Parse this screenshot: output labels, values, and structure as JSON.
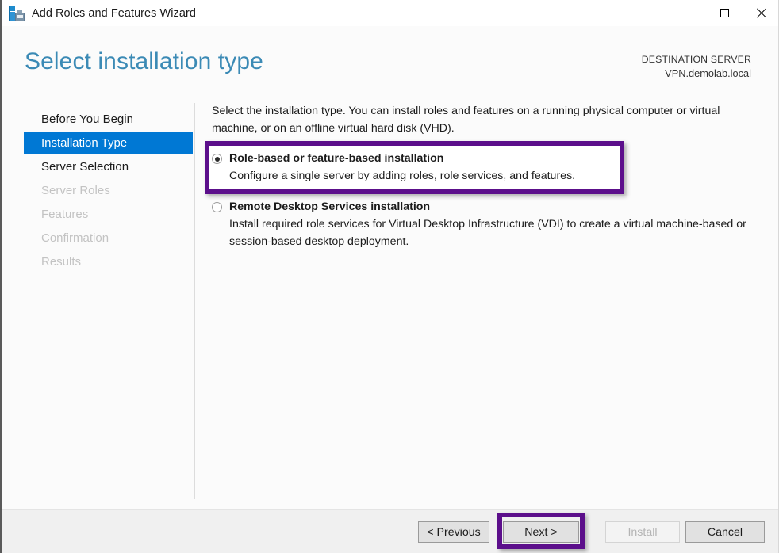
{
  "window": {
    "title": "Add Roles and Features Wizard",
    "app_icon": "server-icon",
    "controls": {
      "minimize": "minimize-icon",
      "maximize": "maximize-icon",
      "close": "close-icon"
    }
  },
  "header": {
    "page_title": "Select installation type",
    "destination_label": "DESTINATION SERVER",
    "destination_value": "VPN.demolab.local"
  },
  "sidebar": {
    "items": [
      {
        "label": "Before You Begin",
        "state": "enabled"
      },
      {
        "label": "Installation Type",
        "state": "selected"
      },
      {
        "label": "Server Selection",
        "state": "enabled"
      },
      {
        "label": "Server Roles",
        "state": "disabled"
      },
      {
        "label": "Features",
        "state": "disabled"
      },
      {
        "label": "Confirmation",
        "state": "disabled"
      },
      {
        "label": "Results",
        "state": "disabled"
      }
    ]
  },
  "main": {
    "intro": "Select the installation type. You can install roles and features on a running physical computer or virtual machine, or on an offline virtual hard disk (VHD).",
    "options": [
      {
        "title": "Role-based or feature-based installation",
        "description": "Configure a single server by adding roles, role services, and features.",
        "selected": true
      },
      {
        "title": "Remote Desktop Services installation",
        "description": "Install required role services for Virtual Desktop Infrastructure (VDI) to create a virtual machine-based or session-based desktop deployment.",
        "selected": false
      }
    ]
  },
  "footer": {
    "buttons": [
      {
        "label": "< Previous",
        "enabled": true
      },
      {
        "label": "Next >",
        "enabled": true
      },
      {
        "label": "Install",
        "enabled": false
      },
      {
        "label": "Cancel",
        "enabled": true
      }
    ]
  },
  "annotations": {
    "color": "#5c0f8b",
    "highlighted": [
      "role-based-option",
      "next-button"
    ]
  },
  "colors": {
    "accent_blue": "#0078d4",
    "title_blue": "#3b8ab5",
    "annotation_purple": "#5c0f8b",
    "window_bg": "#fbfbfb",
    "footer_bg": "#f0f0f0"
  }
}
